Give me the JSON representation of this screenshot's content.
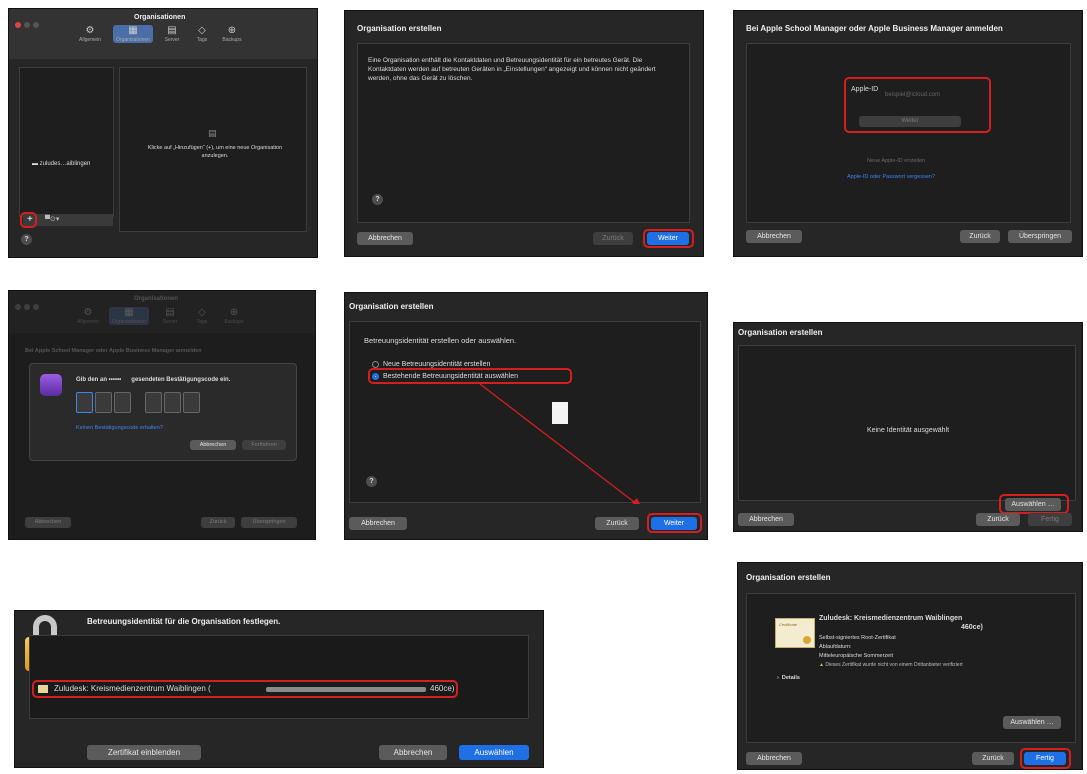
{
  "p1": {
    "title": "Organisationen",
    "tabs": [
      "Allgemein",
      "Organisationen",
      "Server",
      "Tags",
      "Backups"
    ],
    "org_item": "zuludes…aiblingen",
    "empty_hint": "Klicke auf „Hinzufügen“ (+), um eine neue Organisation anzulegen.",
    "add_label": "+",
    "help": "?"
  },
  "p2": {
    "title": "Organisation erstellen",
    "body": "Eine Organisation enthält die Kontaktdaten und Betreuungsidentität für ein betreutes Gerät. Die Kontaktdaten werden auf betreuten Geräten in „Einstellungen“ angezeigt und können nicht geändert werden, ohne das Gerät zu löschen.",
    "cancel": "Abbrechen",
    "back": "Zurück",
    "next": "Weiter",
    "help": "?"
  },
  "p3": {
    "title": "Bei Apple School Manager oder Apple Business Manager anmelden",
    "apple_id_label": "Apple-ID",
    "apple_id_placeholder": "beispiel@icloud.com",
    "continue": "Weiter",
    "new_id": "Neue Apple-ID erstellen",
    "forgot": "Apple-ID oder Passwort vergessen?",
    "cancel": "Abbrechen",
    "back": "Zurück",
    "skip": "Überspringen"
  },
  "p4": {
    "title": "Organisationen",
    "tabs": [
      "Allgemein",
      "Organisationen",
      "Server",
      "Tags",
      "Backups"
    ],
    "heading": "Bei Apple School Manager oder Apple Business Manager anmelden",
    "prompt_a": "Gib den an ••••••",
    "prompt_b": "gesendeten Bestätigungscode ein.",
    "no_code": "Keinen Bestätigungscode erhalten?",
    "cancel_small": "Abbrechen",
    "continue_small": "Fortfahren",
    "cancel": "Abbrechen",
    "back": "Zurück",
    "skip": "Überspringen"
  },
  "p5": {
    "title": "Organisation erstellen",
    "heading": "Betreuungsidentität erstellen oder auswählen.",
    "option_new": "Neue Betreuungsidentität erstellen",
    "option_existing": "Bestehende Betreuungsidentität auswählen",
    "cancel": "Abbrechen",
    "back": "Zurück",
    "next": "Weiter",
    "help": "?"
  },
  "p6": {
    "title": "Organisation erstellen",
    "no_identity": "Keine Identität ausgewählt",
    "choose": "Auswählen …",
    "cancel": "Abbrechen",
    "back": "Zurück",
    "done": "Fertig"
  },
  "p7": {
    "title": "Betreuungsidentität für die Organisation festlegen.",
    "row_text": "Zuludesk: Kreismedienzentrum Waiblingen (",
    "row_suffix": "460ce)",
    "show_cert": "Zertifikat einblenden",
    "cancel": "Abbrechen",
    "choose": "Auswählen"
  },
  "p8": {
    "title": "Organisation erstellen",
    "cert_name": "Zuludesk: Kreismedienzentrum Waiblingen",
    "cert_suffix": "460ce)",
    "self_signed": "Selbst-signiertes Root-Zertifikat",
    "expires": "Ablaufdatum:",
    "tz": "Mitteleuropäische Sommerzeit",
    "warning": "Dieses Zertifikat wurde nicht von einem Drittanbieter verifiziert",
    "details": "Details",
    "choose": "Auswählen …",
    "cancel": "Abbrechen",
    "back": "Zurück",
    "done": "Fertig",
    "cert_thumb": "Certificate"
  },
  "colors": {
    "accent": "#1f6fe6",
    "highlight": "#d61e1e",
    "panel": "#262626"
  }
}
